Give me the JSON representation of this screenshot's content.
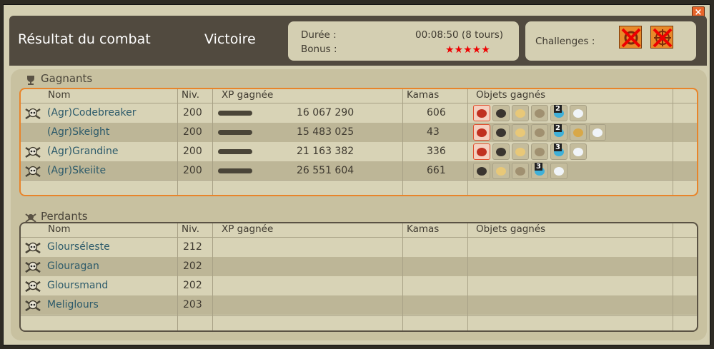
{
  "header": {
    "title": "Résultat du combat",
    "result": "Victoire",
    "duration_label": "Durée :",
    "duration_value": "00:08:50 (8 tours)",
    "bonus_label": "Bonus :",
    "bonus_stars": "★★★★★",
    "challenges_label": "Challenges :"
  },
  "close_icon": "×",
  "winners": {
    "title": "Gagnants",
    "columns": {
      "name": "Nom",
      "level": "Niv.",
      "xp": "XP gagnée",
      "kamas": "Kamas",
      "items": "Objets gagnés"
    },
    "rows": [
      {
        "name": "(Agr)Codebreaker",
        "level": "200",
        "xp": "16 067 290",
        "kamas": "606",
        "skull": true,
        "items": [
          {
            "icon": "pink-scroll-icon",
            "qty": ""
          },
          {
            "icon": "dark-horn-icon",
            "qty": ""
          },
          {
            "icon": "feather-icon",
            "qty": ""
          },
          {
            "icon": "wing-icon",
            "qty": ""
          },
          {
            "icon": "blue-potion-icon",
            "qty": "2"
          },
          {
            "icon": "white-fur-icon",
            "qty": ""
          }
        ]
      },
      {
        "name": "(Agr)Skeight",
        "level": "200",
        "xp": "15 483 025",
        "kamas": "43",
        "skull": false,
        "items": [
          {
            "icon": "pink-scroll-icon",
            "qty": ""
          },
          {
            "icon": "dark-horn-icon",
            "qty": ""
          },
          {
            "icon": "feather-icon",
            "qty": ""
          },
          {
            "icon": "wing-icon",
            "qty": ""
          },
          {
            "icon": "blue-potion-icon",
            "qty": "2"
          },
          {
            "icon": "golden-claw-icon",
            "qty": ""
          },
          {
            "icon": "white-fur-icon",
            "qty": ""
          }
        ]
      },
      {
        "name": "(Agr)Grandine",
        "level": "200",
        "xp": "21 163 382",
        "kamas": "336",
        "skull": true,
        "items": [
          {
            "icon": "pink-scroll-icon",
            "qty": ""
          },
          {
            "icon": "dark-horn-icon",
            "qty": ""
          },
          {
            "icon": "feather-icon",
            "qty": ""
          },
          {
            "icon": "wing-icon",
            "qty": ""
          },
          {
            "icon": "blue-potion-icon",
            "qty": "3"
          },
          {
            "icon": "white-fur-icon",
            "qty": ""
          }
        ]
      },
      {
        "name": "(Agr)Skeiite",
        "level": "200",
        "xp": "26 551 604",
        "kamas": "661",
        "skull": true,
        "items": [
          {
            "icon": "dark-horn-icon",
            "qty": ""
          },
          {
            "icon": "feather-icon",
            "qty": ""
          },
          {
            "icon": "wing-icon",
            "qty": ""
          },
          {
            "icon": "blue-potion-icon",
            "qty": "3"
          },
          {
            "icon": "white-fur-icon",
            "qty": ""
          }
        ]
      }
    ]
  },
  "losers": {
    "title": "Perdants",
    "columns": {
      "name": "Nom",
      "level": "Niv.",
      "xp": "XP gagnée",
      "kamas": "Kamas",
      "items": "Objets gagnés"
    },
    "rows": [
      {
        "name": "Glourséleste",
        "level": "212"
      },
      {
        "name": "Glouragan",
        "level": "202"
      },
      {
        "name": "Gloursmand",
        "level": "202"
      },
      {
        "name": "Meliglours",
        "level": "203"
      }
    ]
  }
}
